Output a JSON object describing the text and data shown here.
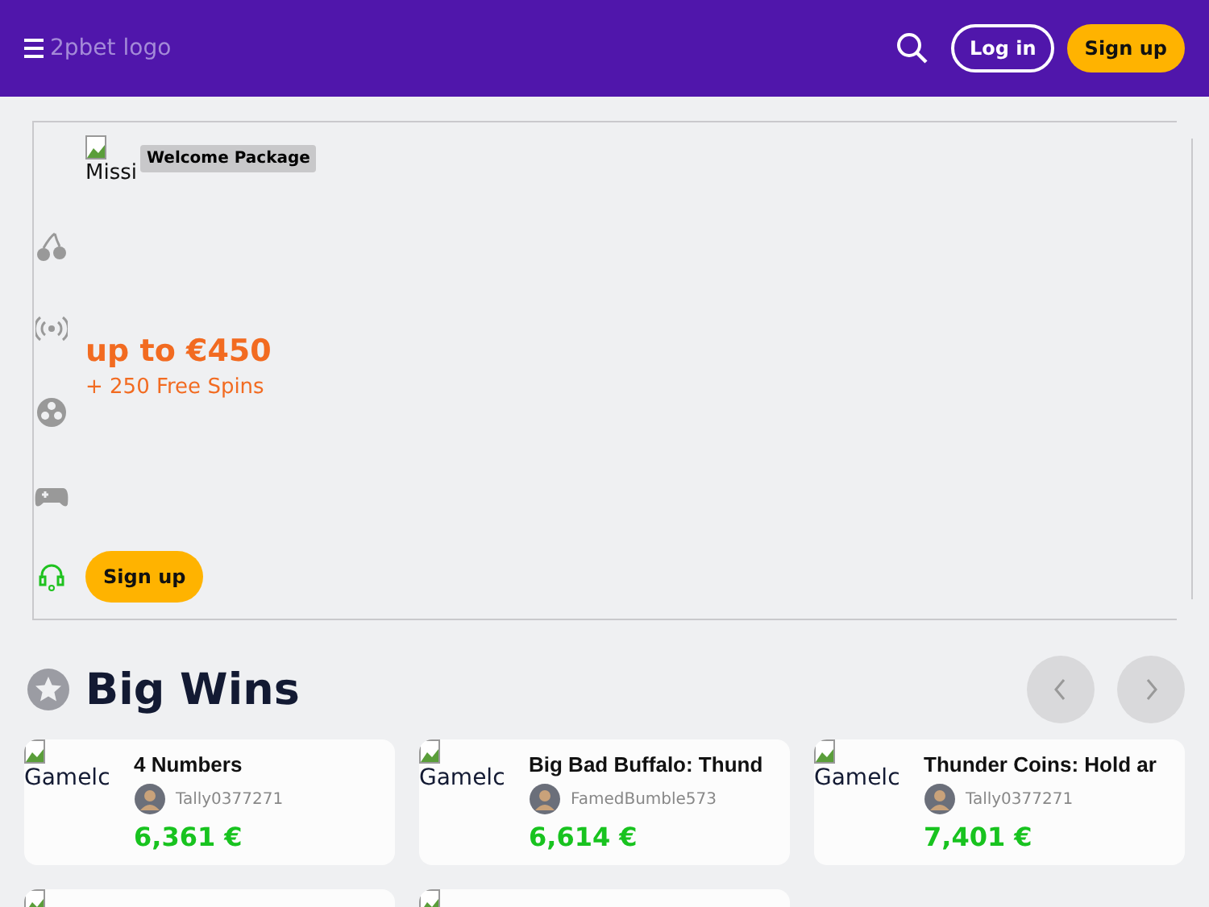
{
  "header": {
    "logo_alt": "2pbet logo",
    "log_in": "Log in",
    "sign_up": "Sign up"
  },
  "banner": {
    "image_alt": "Missi",
    "badge": "Welcome Package",
    "headline": "up to €450",
    "subline": "+ 250 Free Spins",
    "button": "Sign up"
  },
  "big_wins": {
    "title": "Big Wins",
    "cards": [
      {
        "image_alt": "Gamelc",
        "game": "4 Numbers",
        "player": "Tally0377271",
        "amount": "6,361 €"
      },
      {
        "image_alt": "Gamelc",
        "game": "Big Bad Buffalo: Thund",
        "player": "FamedBumble573",
        "amount": "6,614 €"
      },
      {
        "image_alt": "Gamelc",
        "game": "Thunder Coins: Hold ar",
        "player": "Tally0377271",
        "amount": "7,401 €"
      }
    ]
  }
}
